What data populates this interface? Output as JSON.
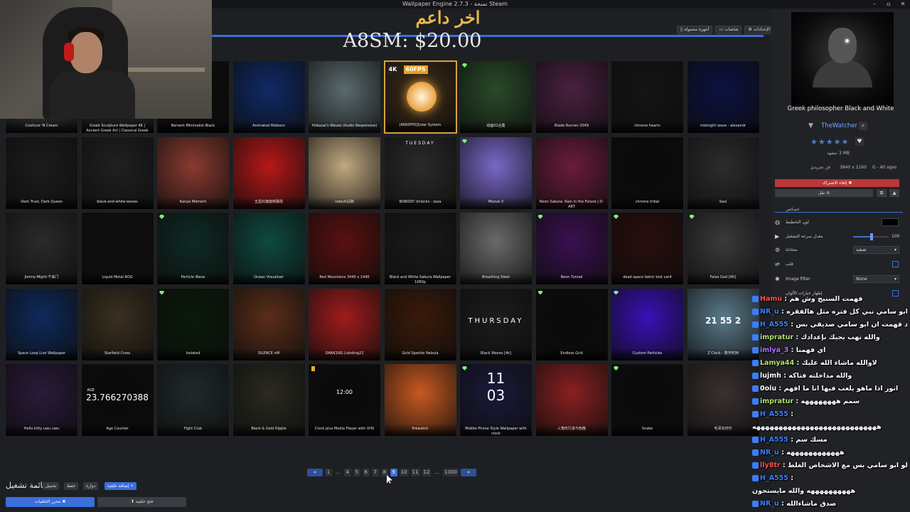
{
  "window": {
    "title": "Wallpaper Engine 2.7.3 - نسخة Steam",
    "minimize": "–",
    "maximize": "▫",
    "close": "✕"
  },
  "donation": {
    "title": "اخر داعم",
    "amount": "A8SM: $20.00"
  },
  "toolbar": {
    "settings": "⚙ الإعدادات",
    "displays": "▭ شاشات",
    "mobile": "▯ أجهزة محمولة"
  },
  "tiles": [
    {
      "title": "Coolture 'N Cream",
      "color": "#3a3838"
    },
    {
      "title": "Greek Sculpture Wallpaper 4K | Ancient Greek Art | Classical Greek Statue |",
      "color": "#2a2a2a"
    },
    {
      "title": "Berserk Minimalist Black",
      "color": "#0b0b0b"
    },
    {
      "title": "Animated Ribbons",
      "color": "#102a66"
    },
    {
      "title": "Hokusai's Waves (Audio Responsive)",
      "color": "#5b6a6e"
    },
    {
      "title": "[4K60FPS]Solar System",
      "color": "#3c2c18",
      "badge": "4K",
      "badge2": "60FPS",
      "selected": true
    },
    {
      "title": "动画01合集",
      "color": "#2a4a2a",
      "gem": true
    },
    {
      "title": "Blade Runner 2049",
      "color": "#4a2040"
    },
    {
      "title": "chrome hearts",
      "color": "#151515"
    },
    {
      "title": "midnight wave - alexandr",
      "color": "#0c1240"
    },
    {
      "title": "Dark Trust, Dark Queen",
      "color": "#1c1c1c"
    },
    {
      "title": "black-and-white-waves",
      "color": "#202020"
    },
    {
      "title": "Kanye Moment",
      "color": "#8a3a30"
    },
    {
      "title": "五星红旗旋转飘扬",
      "color": "#b81818"
    },
    {
      "title": "coke大白碗",
      "color": "#c0a880"
    },
    {
      "title": "NOBODY Unlocks - zaza",
      "color": "#2a2a2a",
      "big": "TUESDAY"
    },
    {
      "title": "Moove 3",
      "color": "#7a68c8",
      "gem": true
    },
    {
      "title": "Neon Sakura: Rain in the Future | D-ART",
      "color": "#6a1c3a"
    },
    {
      "title": "chrome tribal",
      "color": "#0a0a0a"
    },
    {
      "title": "Saxi",
      "color": "#2c2c2c"
    },
    {
      "title": "Jimmy-Might-千由门",
      "color": "#2a2a2a"
    },
    {
      "title": "Liquid Metal ROG",
      "color": "#0e0e0e"
    },
    {
      "title": "Particle Wave",
      "color": "#0e2a24",
      "gem": true
    },
    {
      "title": "Ocean Visualizer",
      "color": "#0e4a40"
    },
    {
      "title": "Red Mountains 3440 x 1440",
      "color": "#5a1010"
    },
    {
      "title": "Black and White Sakura Wallpaper 1080p",
      "color": "#1a1a1a"
    },
    {
      "title": "Breathing Steel",
      "color": "#6a6a6a"
    },
    {
      "title": "Neon Tunnel",
      "color": "#3a1050",
      "gem": true
    },
    {
      "title": "dead space fabric test var4",
      "color": "#2a0e0e",
      "gem": true
    },
    {
      "title": "False God [4K]",
      "color": "#3a3a3a",
      "gem": true
    },
    {
      "title": "Space Loop Live Wallpaper",
      "color": "#0e2a5a"
    },
    {
      "title": "Starfield Cross",
      "color": "#3a3020"
    },
    {
      "title": "Isolated",
      "color": "#0a1a0a",
      "gem": true
    },
    {
      "title": "SILENCE nM",
      "color": "#5a2e18"
    },
    {
      "title": "DANK1NG Lishding22",
      "color": "#a01c1c"
    },
    {
      "title": "Gold Sparkle Nebula",
      "color": "#3a1a0a"
    },
    {
      "title": "Black Waves [4k]",
      "color": "#1c1c1c",
      "big": "THURSDAY"
    },
    {
      "title": "Endless Grid",
      "color": "#0a0a0a",
      "gem": true
    },
    {
      "title": "Custom Particles",
      "color": "#3a10b8",
      "gem": true
    },
    {
      "title": "Z Clock - 数字时钟",
      "color": "#5a7a8a",
      "big": "21 55 2"
    },
    {
      "title": "Hello kitty uwu uwu",
      "color": "#2a1a3a"
    },
    {
      "title": "Age Counter",
      "color": "#0a0a0a",
      "big": "23.766270388",
      "small": "AGE"
    },
    {
      "title": "Fight Club",
      "color": "#202a2a"
    },
    {
      "title": "Black & Gold Ripple",
      "color": "#2a2a20"
    },
    {
      "title": "Clock plus Media Player with VHS",
      "color": "#0a0a0a",
      "big": "12:00",
      "yellow": true
    },
    {
      "title": "firewatch",
      "color": "#c85a20"
    },
    {
      "title": "Mobile Phone Style Wallpaper with clock",
      "color": "#1a1a3a",
      "big": "11\n03",
      "gem": true
    },
    {
      "title": "三角形行进与色散",
      "color": "#8a2020"
    },
    {
      "title": "Snake",
      "color": "#0a0a0a",
      "gem": true
    },
    {
      "title": "毛泽东时代",
      "color": "#3a3030"
    }
  ],
  "pagination": {
    "prev": "«",
    "pages": [
      "1",
      "...",
      "4",
      "5",
      "6",
      "7",
      "8",
      "9",
      "10",
      "11",
      "12",
      "...",
      "1000"
    ],
    "active": "9",
    "next": "»"
  },
  "bottom": {
    "playlist": "قائمة تشغيل",
    "load": "تحميل",
    "save": "حفظ",
    "edit": "دوارة",
    "add": "إضافة خلفية +",
    "open_file": "⬆ فتح خلفية",
    "editor": "محرر الخلفيات ✖"
  },
  "panel": {
    "title": "Greek philosopher Black and White",
    "author": "TheWatcher",
    "stars": "★★★★★",
    "size": "3 MB",
    "views": "مشهد",
    "resolution": "3840 x 2160",
    "rating": "G - All ages",
    "category": "فن تجريدي",
    "unsubscribe": "إلغاء الاشتراك ✖",
    "apply": "نقل ⊘",
    "properties": "خصائص",
    "color_label": "لون التخطيط",
    "speed_label": "معدل سرعة التشغيل",
    "speed_value": "100",
    "align_label": "محاذاة",
    "align_value": "تغطية",
    "flip_label": "قلب",
    "filter_label": "Image filter",
    "filter_value": "None",
    "colors_label": "إظهار خيارات الألوان"
  },
  "chat": [
    {
      "user": "Hamu",
      "msg": "فهمت السنيج وش هم",
      "color": "#ff5050"
    },
    {
      "user": "NR_u",
      "msg": "كلام جميل استاذ ابو سامي نبي كل فتره مثل هالفقره",
      "color": "#3a7dff"
    },
    {
      "user": "H_A555",
      "msg": "عبود فهمت ان ابو سامي صديقي بس",
      "color": "#3a7dff"
    },
    {
      "user": "impratur",
      "msg": "والله تهب يجيك بإعدادك",
      "color": "#b0e070"
    },
    {
      "user": "imlya_3",
      "msg": "اي فهمنا",
      "color": "#b070ff"
    },
    {
      "user": "Lamya44",
      "msg": "لاوالله ماشاء الله عليك",
      "color": "#b0e070"
    },
    {
      "user": "lujmh",
      "msg": "والله مداخلته فتاكه",
      "color": "#ffffff"
    },
    {
      "user": "0oiu",
      "msg": "انور اذا ماهو يلعب فيها انا ما افهم",
      "color": "#ffffff"
    },
    {
      "user": "impratur",
      "msg": "سمم ههههههههه",
      "color": "#b0e070"
    },
    {
      "user": "H_A555",
      "msg": "",
      "color": "#3a7dff"
    },
    {
      "user": "",
      "msg": "ههههههههههههههههههههههههههههه",
      "color": "#ffffff"
    },
    {
      "user": "H_A555",
      "msg": "مسك سم",
      "color": "#3a7dff"
    },
    {
      "user": "NR_u",
      "msg": "ههههههههههههه",
      "color": "#3a7dff"
    },
    {
      "user": "lly8tr",
      "msg": "الصراحه الفالك حلو ابو سامي بس مع الاشخاص الغلط",
      "color": "#ff5050"
    },
    {
      "user": "H_A555",
      "msg": "",
      "color": "#3a7dff"
    },
    {
      "user": "",
      "msg": "ههههههههههه والله مايستحون",
      "color": "#ffffff"
    },
    {
      "user": "NR_u",
      "msg": "صدق ماشاءالله",
      "color": "#3a7dff"
    }
  ]
}
